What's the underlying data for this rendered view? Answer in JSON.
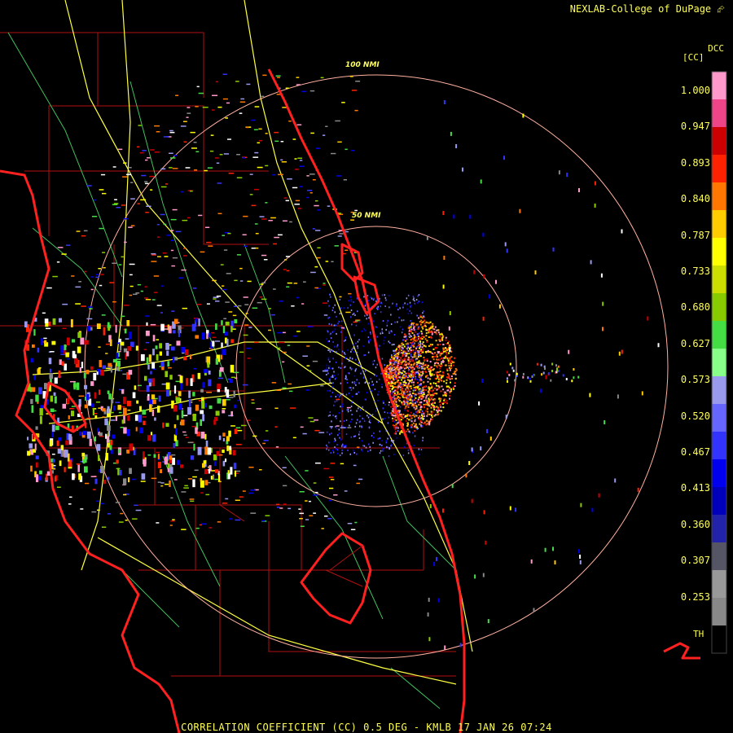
{
  "header": {
    "credit": "NEXLAB-College of DuPage"
  },
  "footer": {
    "title": "CORRELATION COEFFICIENT (CC) 0.5 DEG - KMLB 17 JAN 26 07:24"
  },
  "map": {
    "range_rings": [
      "100 NMI",
      "50 NMI"
    ],
    "colors": {
      "coast": "#ff2020",
      "county": "#b01010",
      "highway": "#ffff40",
      "minor_road": "#40c060",
      "ring": "#ffb0a0"
    }
  },
  "legend": {
    "title": "DCC",
    "units": "[CC]",
    "ticks": [
      "1.000",
      "0.947",
      "0.893",
      "0.840",
      "0.787",
      "0.733",
      "0.680",
      "0.627",
      "0.573",
      "0.520",
      "0.467",
      "0.413",
      "0.360",
      "0.307",
      "0.253"
    ],
    "bottom_label": "TH",
    "colors": [
      "#ff99cc",
      "#ee4488",
      "#cc0000",
      "#ff2200",
      "#ff7700",
      "#ffcc00",
      "#ffff00",
      "#ccdd00",
      "#88cc00",
      "#44dd44",
      "#88ff88",
      "#9999ee",
      "#6666ff",
      "#3333ff",
      "#0000ee",
      "#0000bb",
      "#2222aa",
      "#555566",
      "#999999",
      "#888888",
      "#000000"
    ]
  }
}
